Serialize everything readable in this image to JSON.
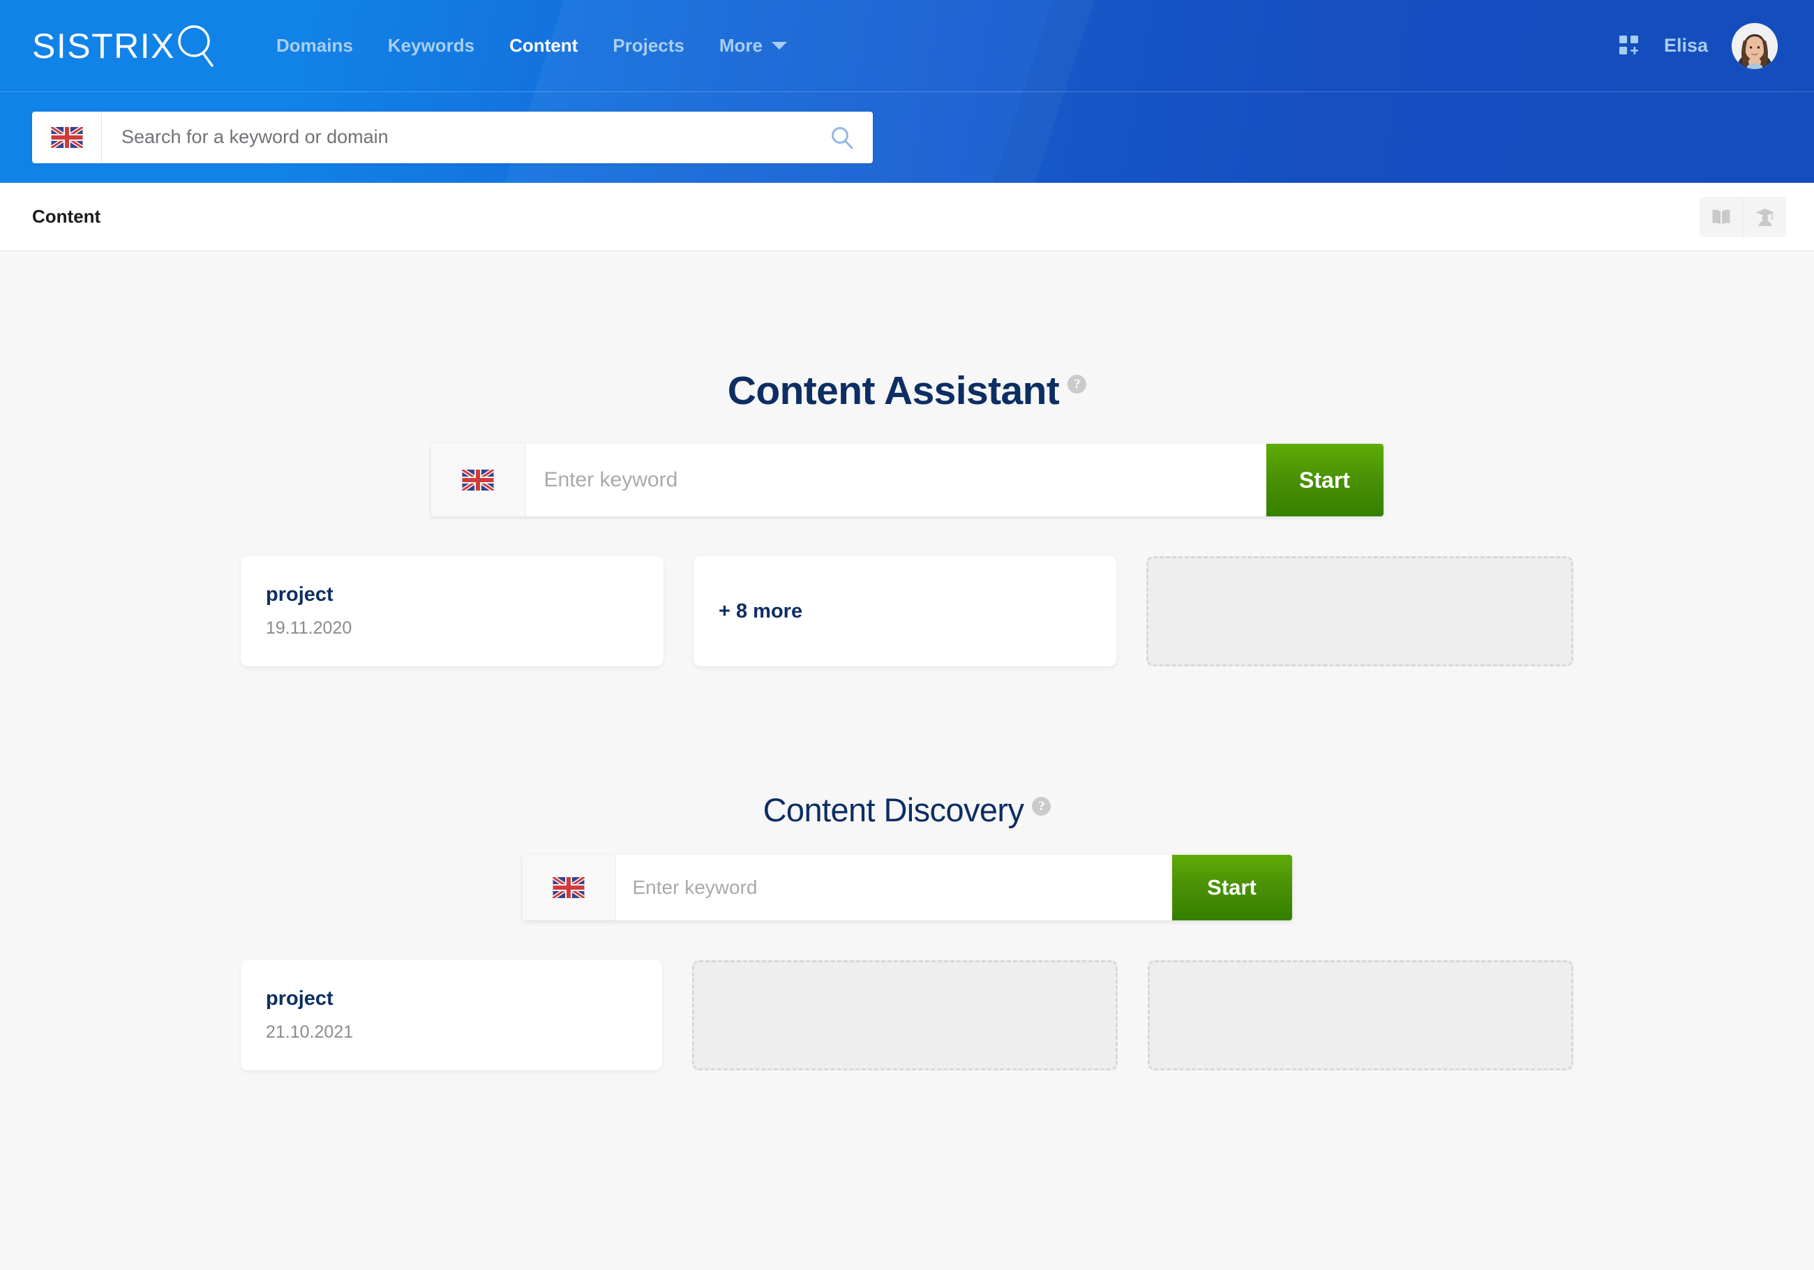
{
  "header": {
    "logo_text": "SISTRIX",
    "logo_icon": "magnifier-icon",
    "nav": [
      {
        "label": "Domains",
        "active": false
      },
      {
        "label": "Keywords",
        "active": false
      },
      {
        "label": "Content",
        "active": true
      },
      {
        "label": "Projects",
        "active": false
      },
      {
        "label": "More",
        "active": false,
        "has_caret": true
      }
    ],
    "apps_icon": "apps-grid-plus-icon",
    "user_name": "Elisa",
    "avatar_icon": "user-avatar",
    "search": {
      "placeholder": "Search for a keyword or domain",
      "value": "",
      "flag": "uk-flag-icon",
      "icon": "search-icon"
    }
  },
  "breadcrumb": {
    "title": "Content",
    "actions": [
      {
        "name": "handbook-icon",
        "label": "Handbook"
      },
      {
        "name": "academy-graduate-icon",
        "label": "Academy"
      }
    ]
  },
  "sections": [
    {
      "id": "content-assistant",
      "title": "Content Assistant",
      "help": "?",
      "input": {
        "placeholder": "Enter keyword",
        "value": "",
        "flag": "uk-flag-icon"
      },
      "start_label": "Start",
      "cards": [
        {
          "type": "project",
          "title": "project",
          "date": "19.11.2020"
        },
        {
          "type": "more",
          "label": "+ 8 more"
        },
        {
          "type": "placeholder"
        }
      ]
    },
    {
      "id": "content-discovery",
      "title": "Content Discovery",
      "help": "?",
      "input": {
        "placeholder": "Enter keyword",
        "value": "",
        "flag": "uk-flag-icon"
      },
      "start_label": "Start",
      "cards": [
        {
          "type": "project",
          "title": "project",
          "date": "21.10.2021"
        },
        {
          "type": "placeholder"
        },
        {
          "type": "placeholder"
        }
      ]
    }
  ],
  "colors": {
    "header_blue_light": "#1183e8",
    "header_blue_dark": "#1550c4",
    "nav_inactive": "#a9cef3",
    "nav_active": "#ffffff",
    "heading_navy": "#0d2e63",
    "start_green": "#4b9205",
    "page_bg": "#f7f7f7",
    "placeholder_gray": "#eeeeee"
  }
}
